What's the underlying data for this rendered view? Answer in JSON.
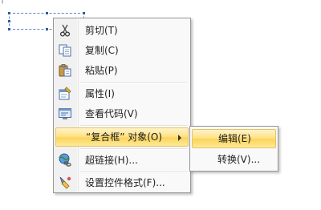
{
  "window": {
    "corner_glyph": "┐"
  },
  "context_menu": {
    "items": [
      {
        "label": "剪切(T)",
        "icon": "scissors-icon"
      },
      {
        "label": "复制(C)",
        "icon": "copy-icon"
      },
      {
        "label": "粘贴(P)",
        "icon": "paste-icon"
      },
      {
        "label": "属性(I)",
        "icon": "properties-icon"
      },
      {
        "label": "查看代码(V)",
        "icon": "view-code-icon"
      },
      {
        "label": "“复合框” 对象(O)",
        "icon": "",
        "has_submenu": true,
        "highlighted": true
      },
      {
        "label": "超链接(H)...",
        "icon": "hyperlink-icon"
      },
      {
        "label": "设置控件格式(F)...",
        "icon": "format-control-icon"
      }
    ]
  },
  "submenu": {
    "items": [
      {
        "label": "编辑(E)",
        "highlighted": true
      },
      {
        "label": "转换(V)..."
      }
    ]
  },
  "colors": {
    "highlight_top": "#fff3c7",
    "highlight_bottom": "#fbd55a",
    "menu_background": "#f9f9f9",
    "menu_border": "#979797",
    "selection_handle": "#2e5aa6"
  }
}
